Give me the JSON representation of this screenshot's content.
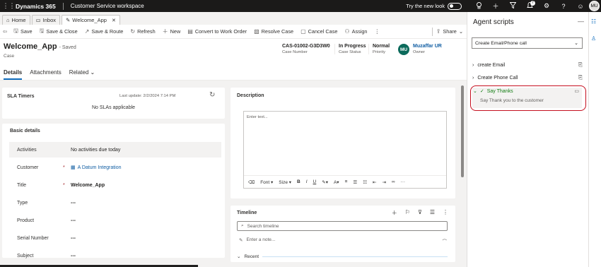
{
  "topbar": {
    "brand": "Dynamics 365",
    "app": "Customer Service workspace",
    "try_label": "Try the new look",
    "notifications": "7",
    "user_initials": "MU",
    "icons": [
      "waffle-icon",
      "lightbulb-icon",
      "plus-icon",
      "filter-icon",
      "bell-icon",
      "settings-icon",
      "help-icon",
      "smiley-icon"
    ]
  },
  "tabs": [
    {
      "label": "Home",
      "icon": "home-icon"
    },
    {
      "label": "Inbox",
      "icon": "inbox-icon"
    },
    {
      "label": "Welcome_App",
      "icon": "pencil-icon"
    }
  ],
  "commands": {
    "save": "Save",
    "save_close": "Save & Close",
    "save_route": "Save & Route",
    "refresh": "Refresh",
    "new": "New",
    "convert": "Convert to Work Order",
    "resolve": "Resolve Case",
    "cancel": "Cancel Case",
    "assign": "Assign",
    "share": "Share"
  },
  "record": {
    "title": "Welcome_App",
    "saved": "- Saved",
    "entity": "Case",
    "case_number": "CAS-01002-G3D3W0",
    "case_number_label": "Case Number",
    "status": "In Progress",
    "status_label": "Case Status",
    "priority": "Normal",
    "priority_label": "Priority",
    "owner_initials": "MU",
    "owner": "Muzaffar UR",
    "owner_label": "Owner"
  },
  "form_tabs": {
    "details": "Details",
    "attachments": "Attachments",
    "related": "Related"
  },
  "sla": {
    "title": "SLA Timers",
    "last_update": "Last update: 2/2/2024 7:14 PM",
    "none": "No SLAs applicable"
  },
  "basic": {
    "title": "Basic details",
    "fields": [
      {
        "label": "Activities",
        "value": "No activities due today"
      },
      {
        "label": "Customer",
        "value": "A Datum Integration",
        "required": "*"
      },
      {
        "label": "Title",
        "value": "Welcome_App",
        "required": "*"
      },
      {
        "label": "Type",
        "value": "---"
      },
      {
        "label": "Product",
        "value": "---"
      },
      {
        "label": "Serial Number",
        "value": "---"
      },
      {
        "label": "Subject",
        "value": "---"
      }
    ]
  },
  "description": {
    "title": "Description",
    "placeholder": "Enter text...",
    "font": "Font",
    "size": "Size"
  },
  "timeline": {
    "title": "Timeline",
    "search": "Search timeline",
    "note": "Enter a note...",
    "recent": "Recent"
  },
  "agent_scripts": {
    "title": "Agent scripts",
    "selected": "Create Email/Phone call",
    "items": [
      {
        "label": "create Email"
      },
      {
        "label": "Create Phone Call"
      }
    ],
    "active_label": "Say Thanks",
    "active_desc": "Say Thank you to the customer"
  }
}
